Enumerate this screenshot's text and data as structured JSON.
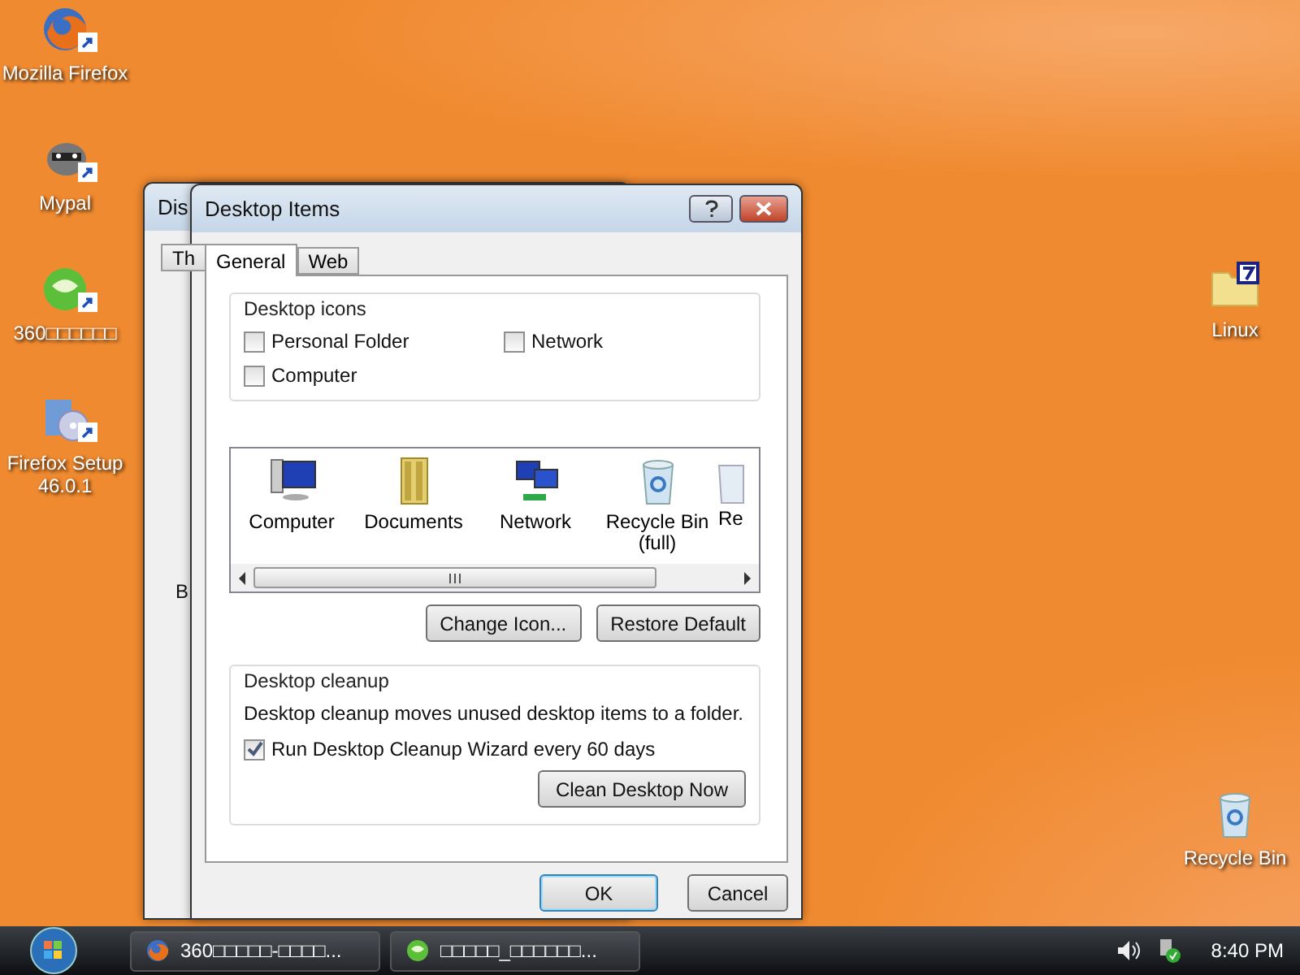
{
  "left_icons": [
    {
      "label": "Mozilla Firefox",
      "kind": "firefox"
    },
    {
      "label": "Mypal",
      "kind": "mypal"
    },
    {
      "label": "360□□□□□□",
      "kind": "globe"
    },
    {
      "label": "Firefox Setup 46.0.1",
      "kind": "setup"
    }
  ],
  "right_icons": [
    {
      "label": "Linux",
      "kind": "folder"
    },
    {
      "label": "Recycle Bin",
      "kind": "bin"
    }
  ],
  "back_window": {
    "title": "Dis",
    "tab": "Th",
    "label": "B"
  },
  "dialog": {
    "title": "Desktop Items",
    "tabs": [
      {
        "label": "General",
        "selected": true
      },
      {
        "label": "Web",
        "selected": false
      }
    ],
    "icons_group": {
      "title": "Desktop icons",
      "options": [
        {
          "label": "Personal Folder",
          "checked": false
        },
        {
          "label": "Network",
          "checked": false
        },
        {
          "label": "Computer",
          "checked": false
        }
      ]
    },
    "icon_list": [
      {
        "label": "Computer",
        "kind": "computer"
      },
      {
        "label": "Documents",
        "kind": "documents"
      },
      {
        "label": "Network",
        "kind": "network"
      },
      {
        "label": "Recycle Bin (full)",
        "kind": "bin"
      },
      {
        "label": "Re",
        "kind": "cut"
      }
    ],
    "icon_buttons": [
      "Change Icon...",
      "Restore Default"
    ],
    "cleanup": {
      "title": "Desktop cleanup",
      "description": "Desktop cleanup moves unused desktop items to a folder.",
      "option": {
        "label": "Run Desktop Cleanup Wizard every 60 days",
        "checked": true
      },
      "button": "Clean Desktop Now"
    },
    "footer_buttons": [
      {
        "label": "OK",
        "default": true
      },
      {
        "label": "Cancel",
        "default": false
      }
    ]
  },
  "taskbar": {
    "items": [
      {
        "label": "360□□□□□-□□□□...",
        "kind": "firefox"
      },
      {
        "label": "□□□□□_□□□□□□...",
        "kind": "globe"
      }
    ],
    "clock": "8:40 PM"
  }
}
